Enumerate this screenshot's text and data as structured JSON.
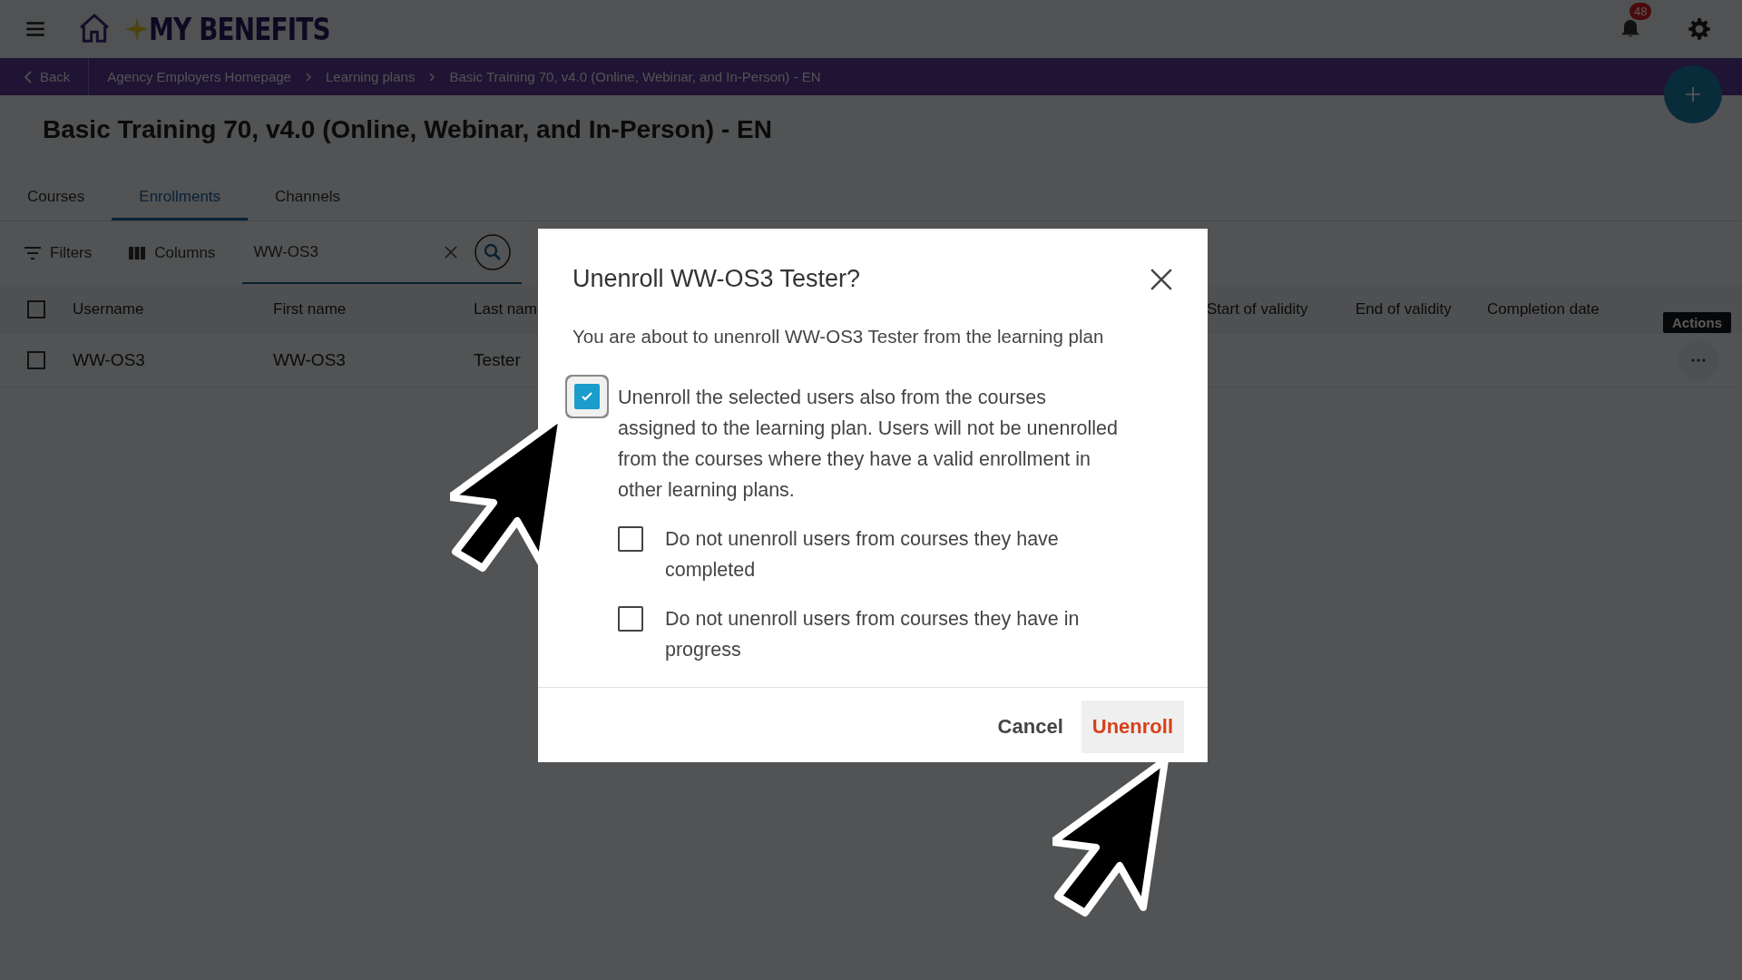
{
  "header": {
    "logo_text": "MY BENEFITS",
    "notification_count": "48"
  },
  "breadcrumb": {
    "back": "Back",
    "items": [
      "Agency Employers Homepage",
      "Learning plans",
      "Basic Training 70, v4.0 (Online, Webinar, and In-Person) - EN"
    ]
  },
  "page_title": "Basic Training 70, v4.0 (Online, Webinar, and In-Person) - EN",
  "tabs": [
    {
      "label": "Courses",
      "selected": false
    },
    {
      "label": "Enrollments",
      "selected": true
    },
    {
      "label": "Channels",
      "selected": false
    }
  ],
  "toolbar": {
    "filters": "Filters",
    "columns": "Columns",
    "search_value": "WW-OS3"
  },
  "table": {
    "columns": [
      "Username",
      "First name",
      "Last nam",
      "Start of validity",
      "End of validity",
      "Completion date"
    ],
    "actions_tooltip": "Actions",
    "all_checked": false,
    "rows": [
      {
        "cells": [
          "WW-OS3",
          "WW-OS3",
          "Tester"
        ],
        "checked": false
      }
    ]
  },
  "dialog": {
    "title": "Unenroll WW-OS3 Tester?",
    "message": "You are about to unenroll WW-OS3 Tester from the learning plan",
    "options": [
      {
        "label": "Unenroll the selected users also from the courses assigned to the learning plan. Users will not be unenrolled from the courses where they have a valid enrollment in other learning plans.",
        "checked": true,
        "children": [
          {
            "label": "Do not unenroll users from courses they have completed",
            "checked": false
          },
          {
            "label": "Do not unenroll users from courses they have in progress",
            "checked": false
          }
        ]
      }
    ],
    "buttons": [
      {
        "label": "Cancel",
        "kind": "secondary"
      },
      {
        "label": "Unenroll",
        "kind": "danger"
      }
    ]
  }
}
